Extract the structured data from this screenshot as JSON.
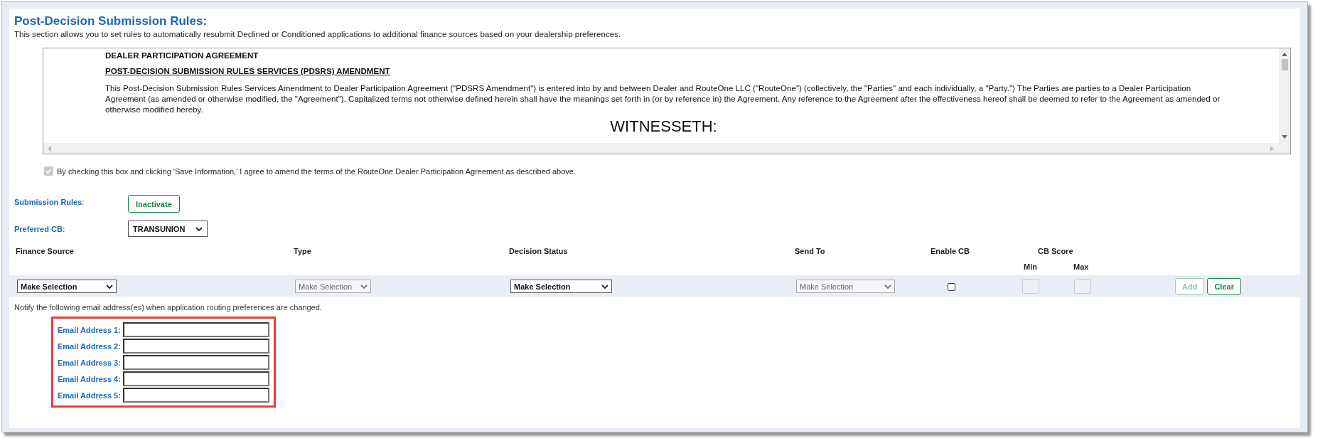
{
  "section": {
    "title": "Post-Decision Submission Rules:",
    "description": "This section allows you to set rules to automatically resubmit Declined or Conditioned applications to additional finance sources based on your dealership preferences."
  },
  "agreement": {
    "heading": "DEALER PARTICIPATION AGREEMENT",
    "subheading": "POST-DECISION SUBMISSION RULES SERVICES (PDSRS) AMENDMENT",
    "body": "This Post-Decision Submission Rules Services Amendment to Dealer Participation Agreement (\"PDSRS Amendment\") is entered into by and between Dealer and RouteOne LLC (\"RouteOne\") (collectively, the \"Parties\" and each individually, a \"Party.\") The Parties are parties to a Dealer Participation Agreement (as amended or otherwise modified, the \"Agreement\"). Capitalized terms not otherwise defined herein shall have the meanings set forth in (or by reference in) the Agreement. Any reference to the Agreement after the effectiveness hereof shall be deemed to refer to the Agreement as amended or otherwise modified hereby.",
    "witness": "WITNESSETH:"
  },
  "consent": {
    "label": "By checking this box and clicking 'Save Information,' I agree to amend the terms of the RouteOne Dealer Participation Agreement as described above.",
    "checked": true,
    "disabled": true
  },
  "submission_rules": {
    "label": "Submission Rules",
    "colon": ":",
    "button": "Inactivate"
  },
  "preferred_cb": {
    "label": "Preferred CB:",
    "value": "TRANSUNION"
  },
  "table": {
    "columns": [
      "Finance Source",
      "Type",
      "Decision Status",
      "Send To",
      "Enable CB",
      "CB Score"
    ],
    "sub_columns": [
      "Min",
      "Max"
    ],
    "row": {
      "finance_source": {
        "value": "Make Selection",
        "disabled": false
      },
      "type": {
        "value": "Make Selection",
        "disabled": true
      },
      "decision_status": {
        "value": "Make Selection",
        "disabled": false
      },
      "send_to": {
        "value": "Make Selection",
        "disabled": true
      },
      "enable_cb": {
        "checked": false
      },
      "min": {
        "disabled": true
      },
      "max": {
        "disabled": true
      }
    },
    "buttons": [
      {
        "label": "Add",
        "disabled": true
      },
      {
        "label": "Clear",
        "disabled": false
      }
    ]
  },
  "notify": {
    "text": "Notify the following email address(es) when application routing preferences are changed.",
    "highlighted": true,
    "fields": [
      {
        "label": "Email Address 1:"
      },
      {
        "label": "Email Address 2:"
      },
      {
        "label": "Email Address 3:"
      },
      {
        "label": "Email Address 4:"
      },
      {
        "label": "Email Address 5:"
      }
    ]
  }
}
